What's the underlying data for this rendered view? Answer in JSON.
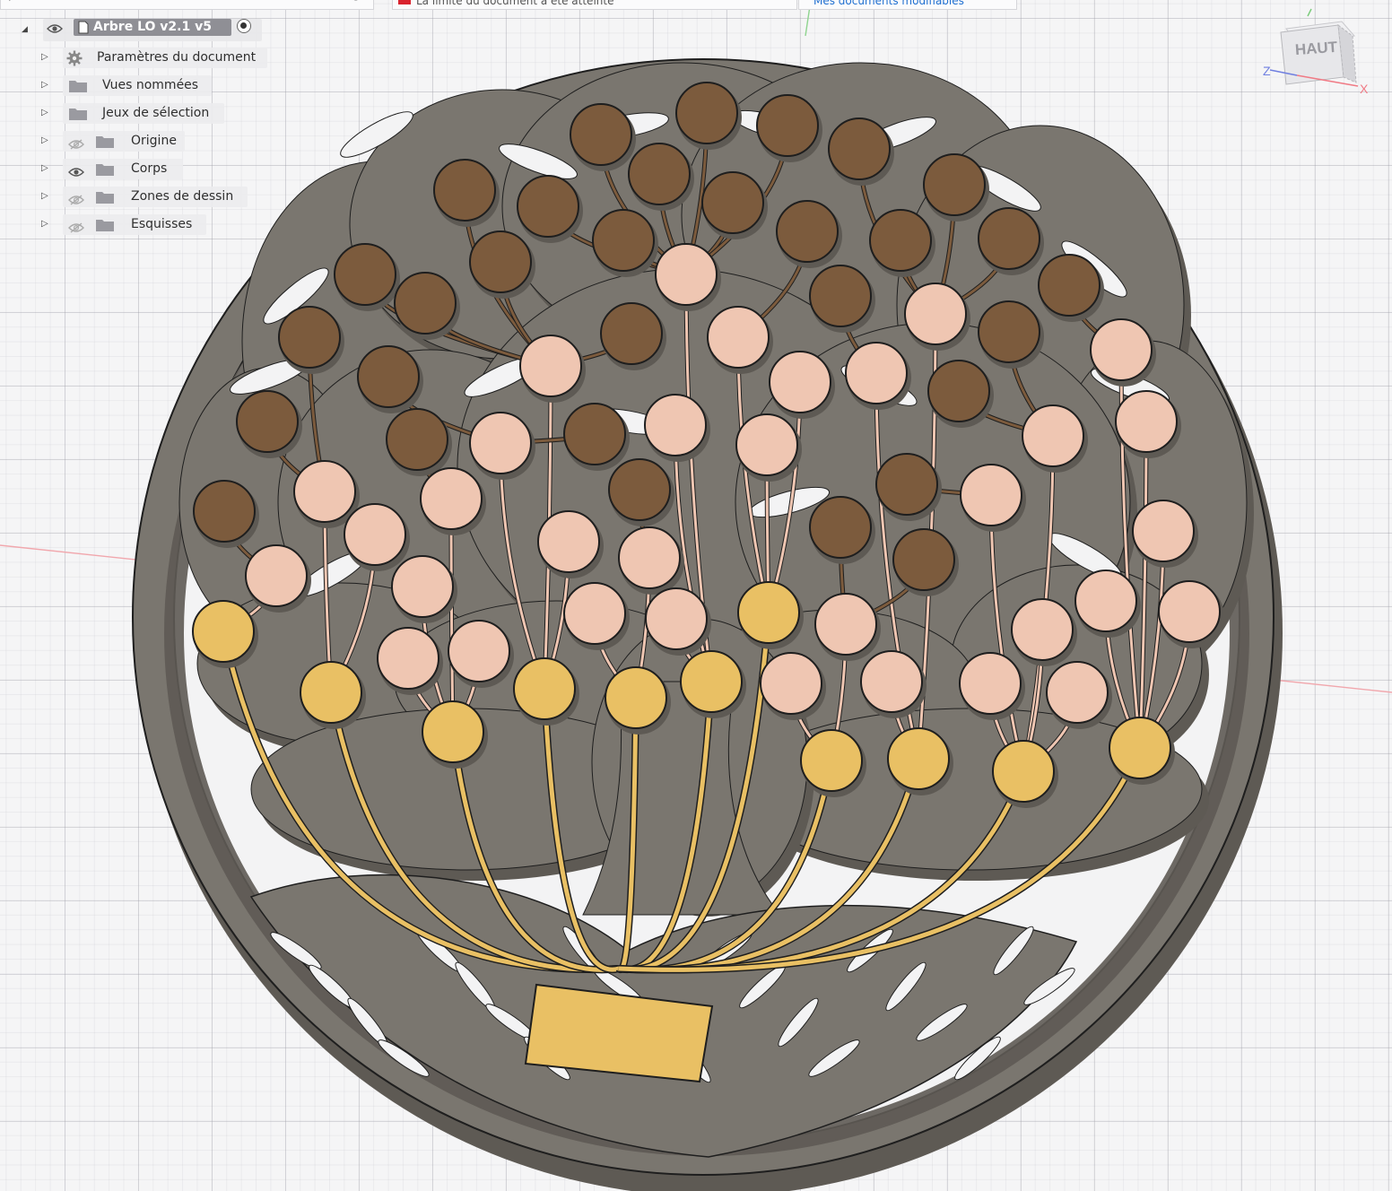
{
  "top_strips": {
    "notice_text": "La limite du document a été atteinte",
    "docs_text": "Mes documents modifiables"
  },
  "browser": {
    "root": {
      "name": "Arbre LO v2.1 v5",
      "visible": true,
      "active": true
    },
    "items": [
      {
        "label": "Paramètres du document",
        "icon": "gear-icon",
        "eye": "none"
      },
      {
        "label": "Vues nommées",
        "icon": "folder-icon",
        "eye": "none"
      },
      {
        "label": "Jeux de sélection",
        "icon": "folder-icon",
        "eye": "none"
      },
      {
        "label": "Origine",
        "icon": "folder-icon",
        "eye": "hidden"
      },
      {
        "label": "Corps",
        "icon": "folder-icon",
        "eye": "visible"
      },
      {
        "label": "Zones de dessin",
        "icon": "folder-icon",
        "eye": "hidden"
      },
      {
        "label": "Esquisses",
        "icon": "folder-icon",
        "eye": "hidden"
      }
    ]
  },
  "viewcube": {
    "face_label": "HAUT",
    "axis_x": "X",
    "axis_z": "Z"
  },
  "colors": {
    "plate": "#7a766f",
    "plate_dark": "#5e5a54",
    "gold": "#e9c064",
    "pink": "#efc6b2",
    "brown": "#7c5b3d",
    "outline": "#1e1e1e",
    "axis_red": "#f1a7ad",
    "axis_green": "#8fd48f"
  }
}
